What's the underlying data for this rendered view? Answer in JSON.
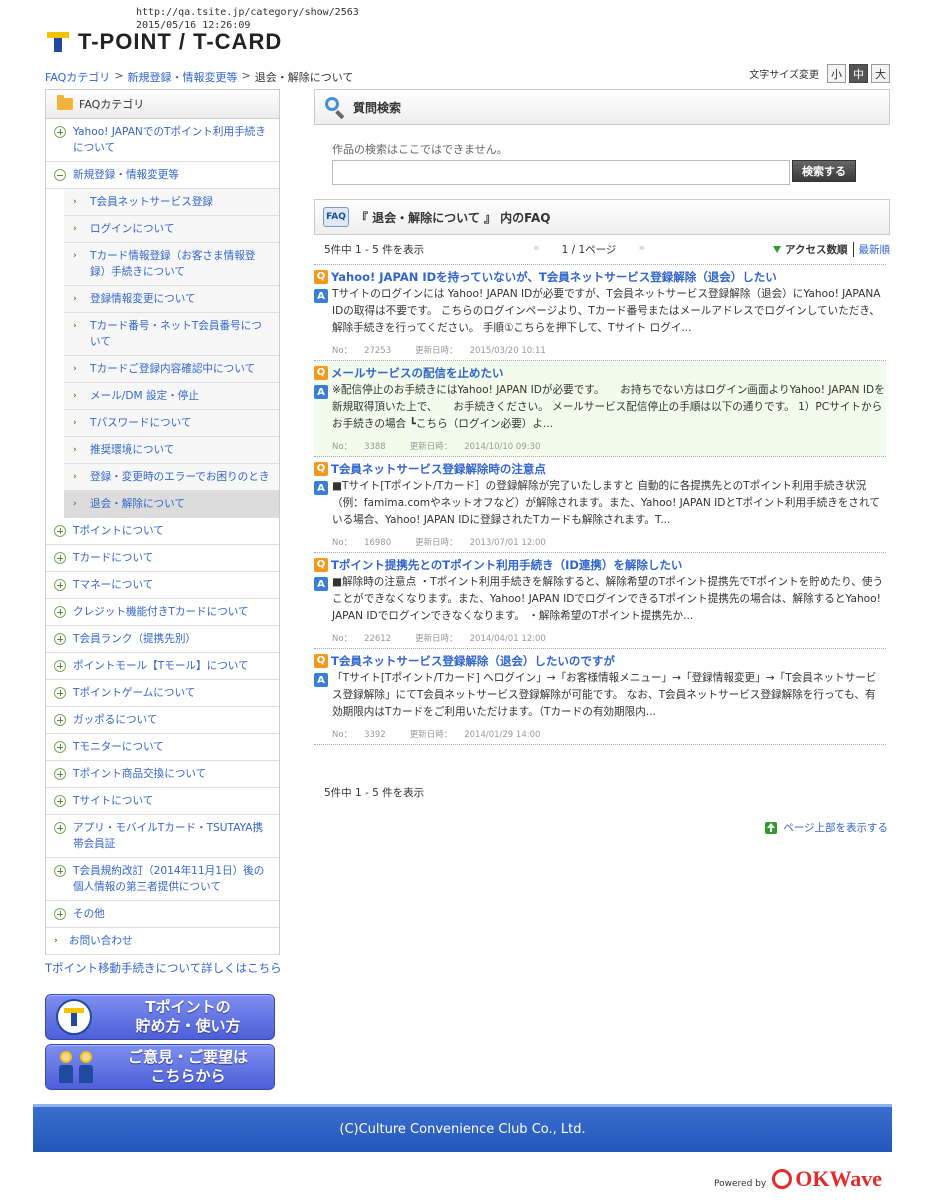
{
  "print_header": {
    "url": "http://qa.tsite.jp/category/show/2563",
    "datetime": "2015/05/16  12:26:09"
  },
  "logo": {
    "text": "T-POINT / T-CARD"
  },
  "breadcrumb": {
    "items": [
      "FAQカテゴリ",
      "新規登録・情報変更等",
      "退会・解除について"
    ],
    "sep": ">"
  },
  "font_size": {
    "label": "文字サイズ変更",
    "small": "小",
    "medium": "中",
    "large": "大"
  },
  "sidebar": {
    "title": "FAQカテゴリ",
    "items": [
      {
        "label": "Yahoo! JAPANでのTポイント利用手続きについて",
        "type": "plus"
      },
      {
        "label": "新規登録・情報変更等",
        "type": "minus"
      },
      {
        "label": "T会員ネットサービス登録",
        "type": "sub"
      },
      {
        "label": "ログインについて",
        "type": "sub"
      },
      {
        "label": "Tカード情報登録（お客さま情報登録）手続きについて",
        "type": "sub"
      },
      {
        "label": "登録情報変更について",
        "type": "sub"
      },
      {
        "label": "Tカード番号・ネットT会員番号について",
        "type": "sub"
      },
      {
        "label": "Tカードご登録内容確認中について",
        "type": "sub"
      },
      {
        "label": "メール/DM 設定・停止",
        "type": "sub"
      },
      {
        "label": "Tパスワードについて",
        "type": "sub"
      },
      {
        "label": "推奨環境について",
        "type": "sub"
      },
      {
        "label": "登録・変更時のエラーでお困りのとき",
        "type": "sub"
      },
      {
        "label": "退会・解除について",
        "type": "sub-active"
      },
      {
        "label": "Tポイントについて",
        "type": "plus"
      },
      {
        "label": "Tカードについて",
        "type": "plus"
      },
      {
        "label": "Tマネーについて",
        "type": "plus"
      },
      {
        "label": "クレジット機能付きTカードについて",
        "type": "plus"
      },
      {
        "label": "T会員ランク（提携先別）",
        "type": "plus"
      },
      {
        "label": "ポイントモール【Tモール】について",
        "type": "plus"
      },
      {
        "label": "Tポイントゲームについて",
        "type": "plus"
      },
      {
        "label": "ガッポるについて",
        "type": "plus"
      },
      {
        "label": "Tモニターについて",
        "type": "plus"
      },
      {
        "label": "Tポイント商品交換について",
        "type": "plus"
      },
      {
        "label": "Tサイトについて",
        "type": "plus"
      },
      {
        "label": "アプリ・モバイルTカード・TSUTAYA携帯会員証",
        "type": "plus"
      },
      {
        "label": "T会員規約改訂（2014年11月1日）後の個人情報の第三者提供について",
        "type": "plus"
      },
      {
        "label": "その他",
        "type": "plus"
      },
      {
        "label": "お問い合わせ",
        "type": "arrow"
      }
    ],
    "move_link": "Tポイント移動手続きについて詳しくはこちら",
    "banner1": "Tポイントの\n貯め方・使い方",
    "banner2": "ご意見・ご要望は\nこちらから"
  },
  "search": {
    "title": "質問検索",
    "note": "作品の検索はここではできません。",
    "value": "",
    "button": "検索する"
  },
  "faq": {
    "title": "『 退会・解除について 』 内のFAQ",
    "icon": "FAQ",
    "count_text": "5件中 1 - 5 件を表示",
    "prev": "«",
    "page_text": "1 / 1ページ",
    "next": "»",
    "sort_access": "アクセス数順",
    "sort_new": "最新順",
    "q_mark": "Q",
    "a_mark": "A",
    "no_label": "No：",
    "date_label": "更新日時：",
    "items": [
      {
        "q": "Yahoo! JAPAN IDを持っていないが、T会員ネットサービス登録解除（退会）したい",
        "a": "Tサイトのログインには Yahoo! JAPAN IDが必要ですが、T会員ネットサービス登録解除（退会）にYahoo! JAPANA IDの取得は不要です。 こちらのログインページより、Tカード番号またはメールアドレスでログインしていただき、解除手続きを行ってください。 手順①こちらを押下して、Tサイト ログイ...",
        "no": "27253",
        "date": "2015/03/20 10:11"
      },
      {
        "q": "メールサービスの配信を止めたい",
        "a": "※配信停止のお手続きにはYahoo! JAPAN IDが必要です。　　お持ちでない方はログイン画面よりYahoo! JAPAN IDを新規取得頂いた上で、　　お手続きください。 メールサービス配信停止の手順は以下の通りです。 1）PCサイトからお手続きの場合 ┗こちら（ログイン必要）よ...",
        "no": "3388",
        "date": "2014/10/10 09:30"
      },
      {
        "q": "T会員ネットサービス登録解除時の注意点",
        "a": "■Tサイト[Tポイント/Tカード］の登録解除が完了いたしますと 自動的に各提携先とのTポイント利用手続き状況（例：famima.comやネットオフなど）が解除されます。また、Yahoo! JAPAN IDとTポイント利用手続きをされている場合、Yahoo! JAPAN IDに登録されたTカードも解除されます。T...",
        "no": "16980",
        "date": "2013/07/01 12:00"
      },
      {
        "q": "Tポイント提携先とのTポイント利用手続き（ID連携）を解除したい",
        "a": "■解除時の注意点 ・Tポイント利用手続きを解除すると、解除希望のTポイント提携先でTポイントを貯めたり、使うことができなくなります。また、Yahoo! JAPAN IDでログインできるTポイント提携先の場合は、解除するとYahoo! JAPAN IDでログインできなくなります。 ・解除希望のTポイント提携先か...",
        "no": "22612",
        "date": "2014/04/01 12:00"
      },
      {
        "q": "T会員ネットサービス登録解除（退会）したいのですが",
        "a": "「Tサイト[Tポイント/Tカード] へログイン」→「お客様情報メニュー」→「登録情報変更」→「T会員ネットサービス登録解除」にてT会員ネットサービス登録解除が可能です。 なお、T会員ネットサービス登録解除を行っても、有効期限内はTカードをご利用いただけます。（Tカードの有効期限内...",
        "no": "3392",
        "date": "2014/01/29 14:00"
      }
    ],
    "count_text_bottom": "5件中 1 - 5 件を表示",
    "to_top": "ページ上部を表示する"
  },
  "footer": {
    "copyright": "(C)Culture Convenience Club Co., Ltd."
  },
  "powered": {
    "label": "Powered by",
    "brand": "OKWave"
  }
}
